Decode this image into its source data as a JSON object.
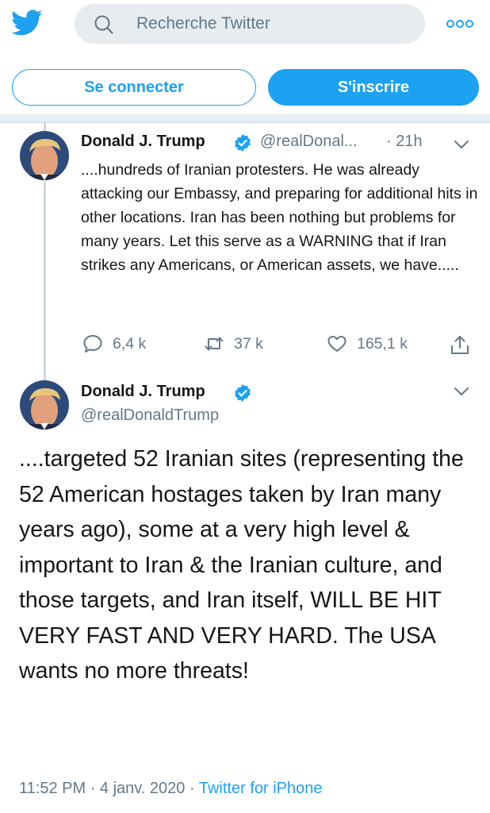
{
  "header": {
    "search_placeholder": "Recherche Twitter"
  },
  "auth": {
    "login_label": "Se connecter",
    "signup_label": "S'inscrire"
  },
  "tweet1": {
    "name": "Donald J. Trump",
    "handle": "@realDonal...",
    "time": "· 21h",
    "text": "....hundreds of Iranian protesters. He was already attacking our Embassy, and preparing for additional hits in other locations. Iran has been nothing but problems for many years. Let this serve as a WARNING that if Iran strikes any Americans, or American assets, we have.....",
    "replies": "6,4 k",
    "retweets": "37 k",
    "likes": "165,1 k"
  },
  "tweet2": {
    "name": "Donald J. Trump",
    "handle": "@realDonaldTrump",
    "text": "....targeted 52 Iranian sites (representing the 52 American hostages taken by Iran many years ago), some at a very high level & important to Iran &  the Iranian culture, and those targets, and Iran itself, WILL BE HIT VERY FAST AND VERY HARD. The USA wants no more threats!",
    "time": "11:52 PM",
    "dot1": "·",
    "date": "4 janv. 2020",
    "dot2": "·",
    "via": "Twitter for iPhone"
  },
  "colors": {
    "accent": "#1da1f2",
    "muted": "#657786",
    "text": "#14171a"
  }
}
